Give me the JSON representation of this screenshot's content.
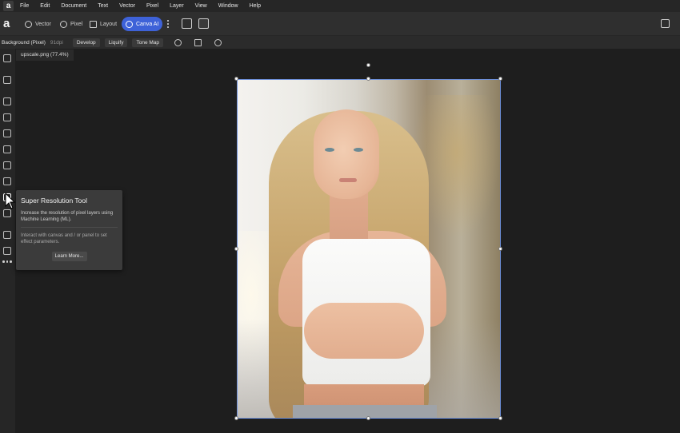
{
  "menubar": {
    "logo": "a",
    "items": [
      "File",
      "Edit",
      "Document",
      "Text",
      "Vector",
      "Pixel",
      "Layer",
      "View",
      "Window",
      "Help"
    ]
  },
  "toolbar": {
    "brand": "a",
    "personas": [
      {
        "label": "Vector",
        "icon": "vector-icon",
        "active": false
      },
      {
        "label": "Pixel",
        "icon": "pixel-icon",
        "active": false
      },
      {
        "label": "Layout",
        "icon": "layout-icon",
        "active": false
      },
      {
        "label": "Canva AI",
        "icon": "canva-ai-icon",
        "active": true
      }
    ],
    "accent_color": "#3e62d8"
  },
  "contextbar": {
    "layer_label": "Background (Pixel)",
    "dpi": "91dpi",
    "buttons": [
      "Develop",
      "Liquify",
      "Tone Map"
    ]
  },
  "document": {
    "tab_label": "upscale.png (77.4%)"
  },
  "tooltip": {
    "title": "Super Resolution Tool",
    "description": "Increase the resolution of pixel layers using Machine Learning (ML).",
    "hint": "Interact with canvas and / or panel to set effect parameters.",
    "button_label": "Learn More..."
  }
}
